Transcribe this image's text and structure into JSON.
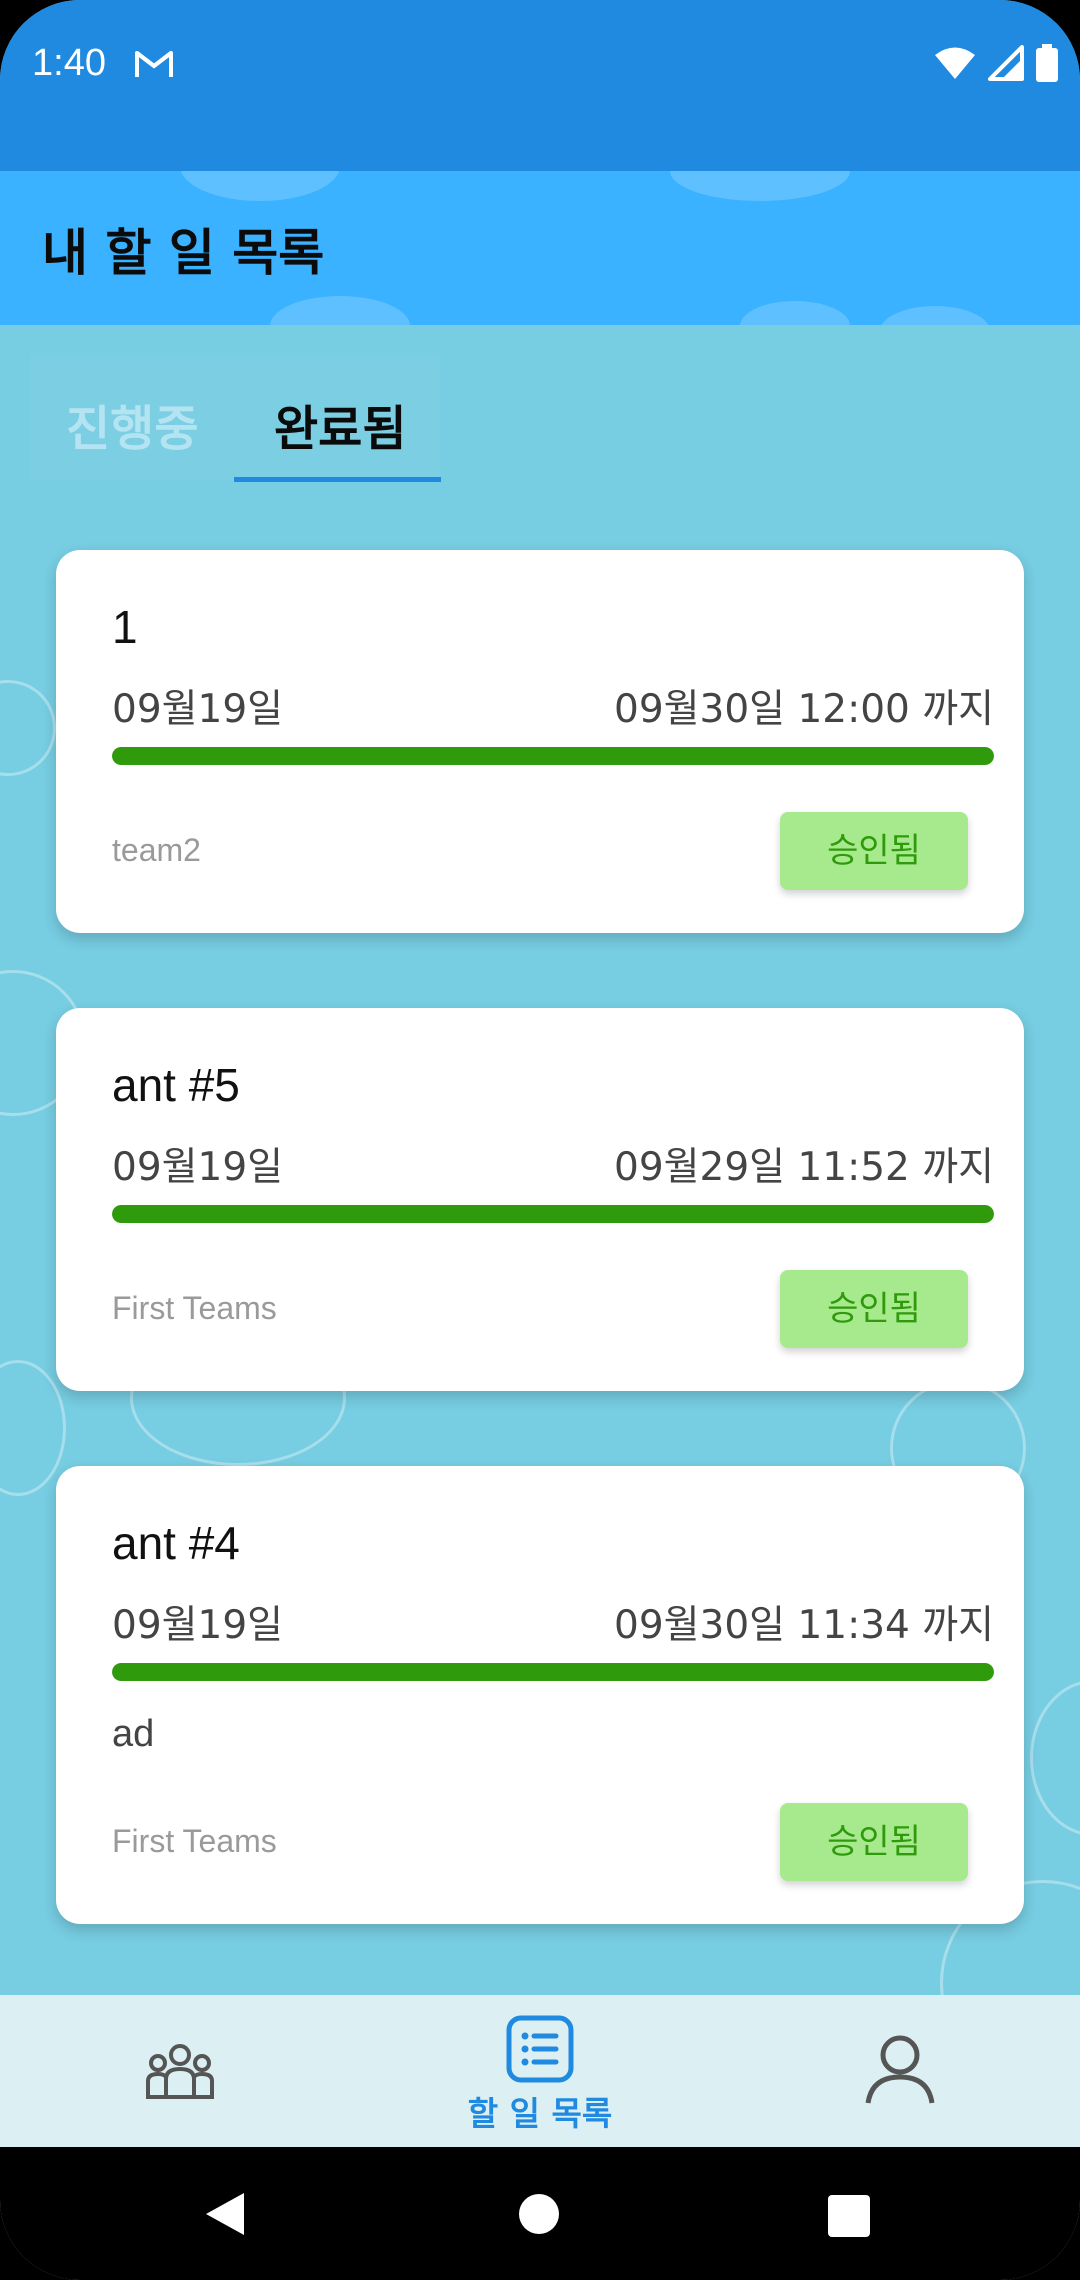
{
  "status_bar": {
    "time": "1:40",
    "icons": [
      "gmail-icon",
      "wifi-icon",
      "signal-icon",
      "battery-icon"
    ]
  },
  "app_bar": {
    "title": "내 할 일 목록"
  },
  "tabs": [
    {
      "label": "진행중",
      "selected": false
    },
    {
      "label": "완료됨",
      "selected": true
    }
  ],
  "tasks": [
    {
      "title": "1",
      "start": "09월19일",
      "due": "09월30일 12:00 까지",
      "progress": 1.0,
      "note": "",
      "team": "team2",
      "status": "승인됨"
    },
    {
      "title": "ant #5",
      "start": "09월19일",
      "due": "09월29일 11:52 까지",
      "progress": 1.0,
      "note": "",
      "team": "First Teams",
      "status": "승인됨"
    },
    {
      "title": "ant #4",
      "start": "09월19일",
      "due": "09월30일 11:34 까지",
      "progress": 1.0,
      "note": "ad",
      "team": "First Teams",
      "status": "승인됨"
    }
  ],
  "bottom_nav": {
    "items": [
      {
        "icon": "team-icon",
        "label": ""
      },
      {
        "icon": "task-list-icon",
        "label": "할 일 목록",
        "selected": true
      },
      {
        "icon": "profile-icon",
        "label": ""
      }
    ]
  },
  "colors": {
    "status_bar": "#2089e0",
    "app_bar": "#3bb2ff",
    "background": "#77cde2",
    "accent": "#1f8ae0",
    "progress": "#2f9a0c",
    "badge_bg": "#a7ea8d"
  }
}
